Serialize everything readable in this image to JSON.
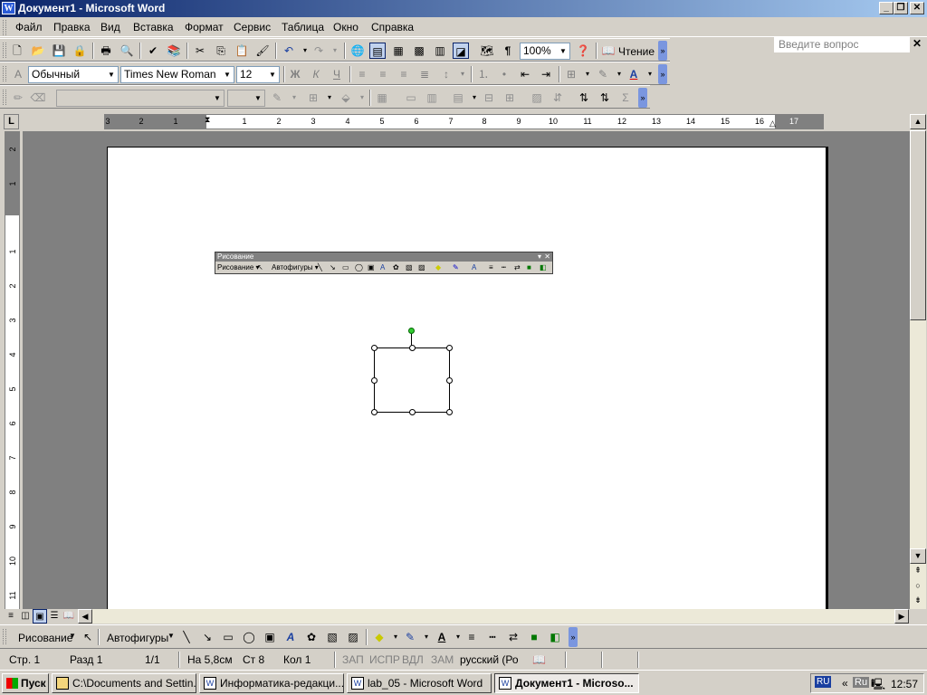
{
  "window": {
    "title": "Документ1 - Microsoft Word",
    "icon": "word-icon"
  },
  "menubar": {
    "items": [
      "Файл",
      "Правка",
      "Вид",
      "Вставка",
      "Формат",
      "Сервис",
      "Таблица",
      "Окно",
      "Справка"
    ],
    "help_placeholder": "Введите вопрос"
  },
  "toolbar_standard": {
    "zoom": "100%",
    "reading": "Чтение"
  },
  "toolbar_format": {
    "style": "Обычный",
    "font": "Times New Roman",
    "size": "12",
    "bold": "Ж",
    "italic": "К",
    "underline": "Ч"
  },
  "ruler": {
    "corner": "L",
    "h_marks": [
      "3",
      "2",
      "1",
      "1",
      "2",
      "3",
      "4",
      "5",
      "6",
      "7",
      "8",
      "9",
      "10",
      "11",
      "12",
      "13",
      "14",
      "15",
      "16",
      "17"
    ],
    "v_marks": [
      "2",
      "1",
      "1",
      "2",
      "3",
      "4",
      "5",
      "6",
      "7",
      "8",
      "9",
      "10",
      "11"
    ]
  },
  "floating_toolbar": {
    "title": "Рисование",
    "draw": "Рисование ▾",
    "autoshapes": "Автофигуры ▾"
  },
  "drawing_toolbar": {
    "draw": "Рисование",
    "autoshapes": "Автофигуры"
  },
  "statusbar": {
    "page": "Стр. 1",
    "section": "Разд 1",
    "pages": "1/1",
    "at": "На 5,8см",
    "line": "Ст 8",
    "col": "Кол 1",
    "rec": "ЗАП",
    "trk": "ИСПР",
    "ext": "ВДЛ",
    "ovr": "ЗАМ",
    "lang": "русский (Ро"
  },
  "taskbar": {
    "start": "Пуск",
    "tasks": [
      {
        "label": "C:\\Documents and Settin..."
      },
      {
        "label": "Информатика-редакци..."
      },
      {
        "label": "lab_05 - Microsoft Word"
      },
      {
        "label": "Документ1 - Microso..."
      }
    ],
    "lang": "RU",
    "tray_lang": "Ru",
    "clock": "12:57"
  }
}
